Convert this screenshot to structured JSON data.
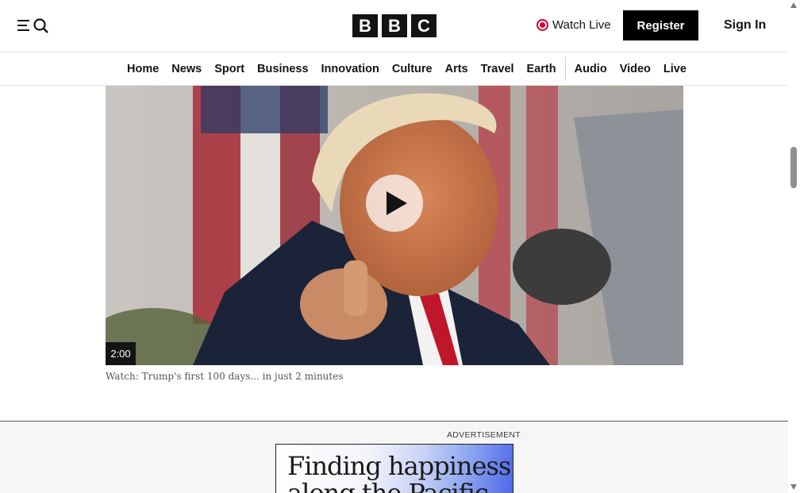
{
  "header": {
    "menu_icon": "menu-icon",
    "search_icon": "search-icon",
    "logo_letters": [
      "B",
      "B",
      "C"
    ],
    "watch_live_label": "Watch Live",
    "register_label": "Register",
    "signin_label": "Sign In"
  },
  "nav": {
    "items": [
      "Home",
      "News",
      "Sport",
      "Business",
      "Innovation",
      "Culture",
      "Arts",
      "Travel",
      "Earth",
      "Audio",
      "Video",
      "Live"
    ]
  },
  "video": {
    "duration": "2:00",
    "caption": "Watch: Trump's first 100 days... in just 2 minutes",
    "play_icon": "play-icon"
  },
  "ad": {
    "label": "ADVERTISEMENT",
    "headline_line1": "Finding happiness",
    "headline_line2": "along the Pacific"
  },
  "colors": {
    "brand_black": "#141414",
    "live_red": "#d4002b"
  }
}
